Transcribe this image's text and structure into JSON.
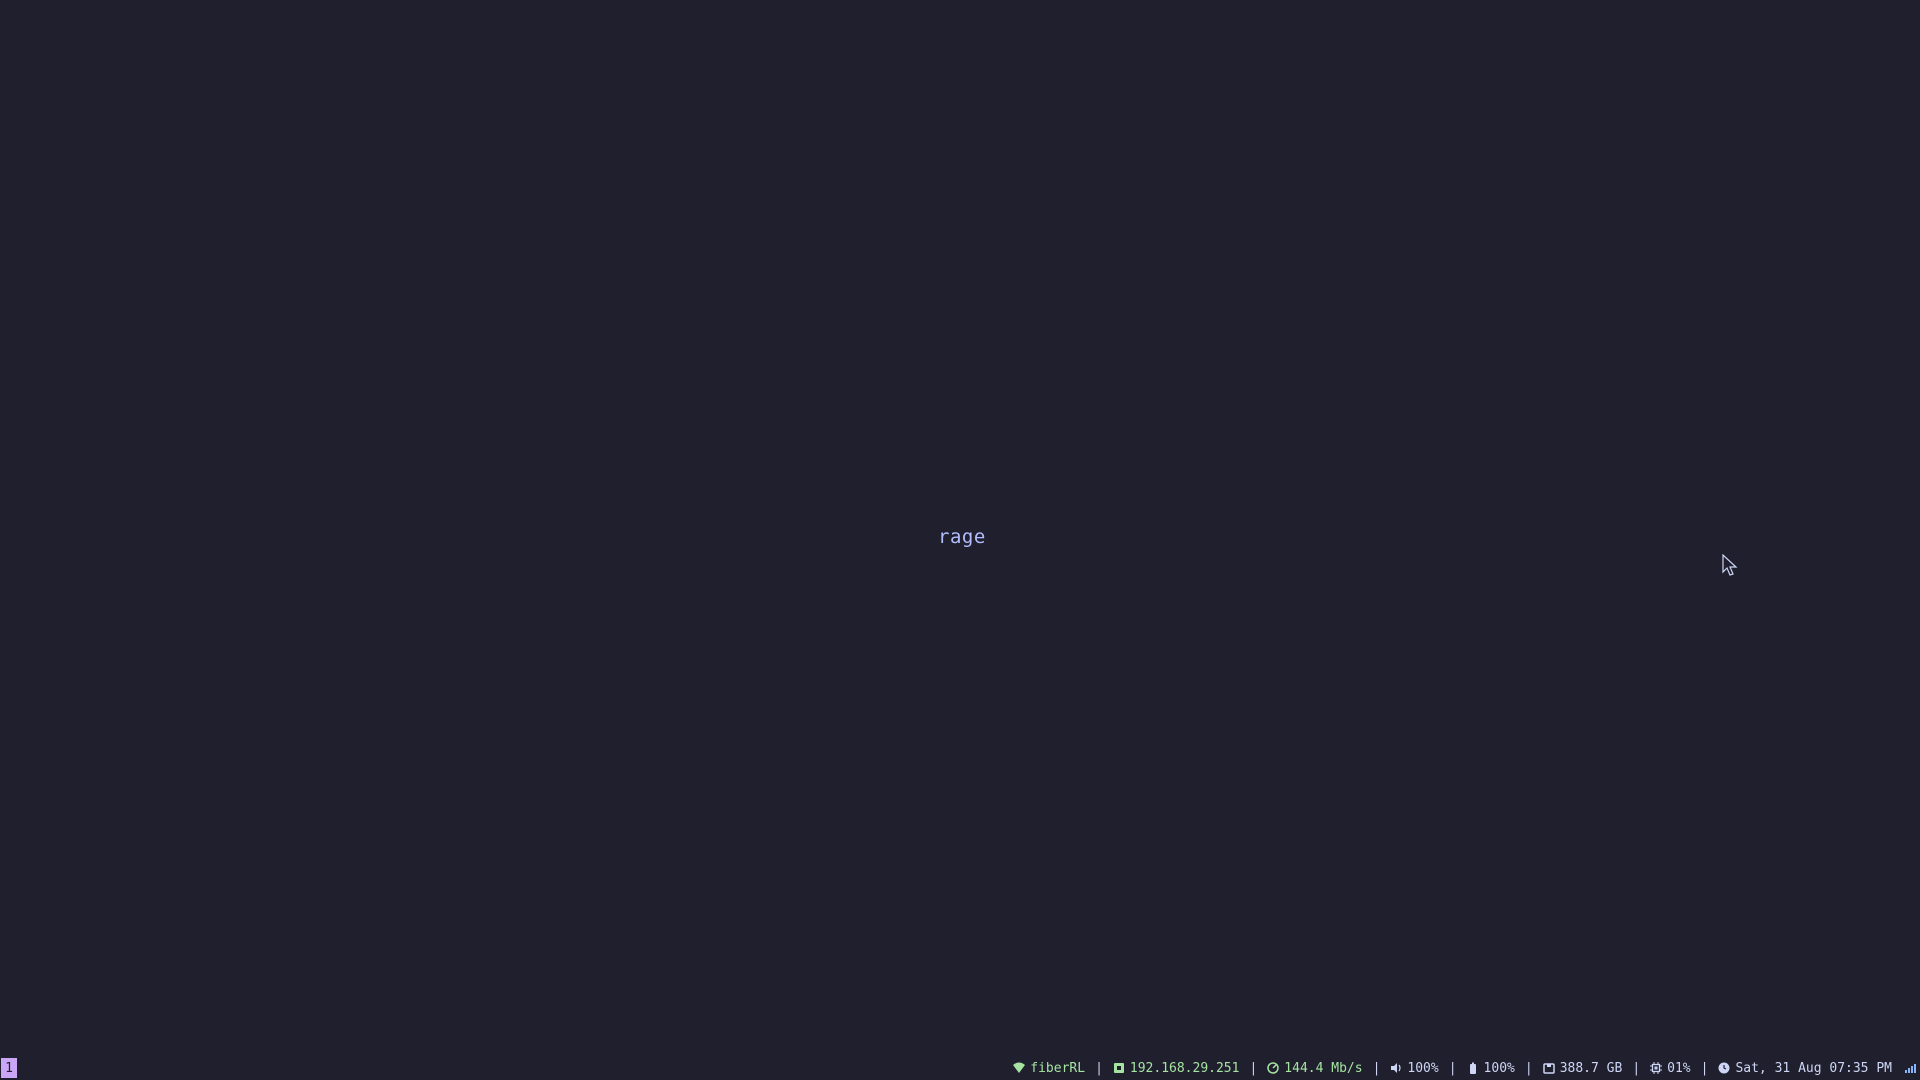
{
  "desktop": {
    "center_text": "rage"
  },
  "bar": {
    "workspace": "1",
    "wifi": {
      "icon": "wifi-icon",
      "label": "fiberRL"
    },
    "ip": {
      "icon": "ethernet-icon",
      "label": "192.168.29.251"
    },
    "speed": {
      "icon": "speedometer-icon",
      "label": "144.4 Mb/s"
    },
    "volume": {
      "icon": "volume-icon",
      "label": "100%"
    },
    "battery": {
      "icon": "battery-icon",
      "label": "100%"
    },
    "disk": {
      "icon": "disk-icon",
      "label": "388.7 GB"
    },
    "cpu": {
      "icon": "cpu-icon",
      "label": "01%"
    },
    "clock": {
      "icon": "clock-icon",
      "label": "Sat, 31 Aug 07:35 PM"
    },
    "separator": "|",
    "tray": {
      "icon": "signal-bars-icon"
    }
  },
  "colors": {
    "background": "#1f1f2e",
    "accent": "#cba6f7",
    "green": "#a6e3a1",
    "text": "#cdd6f4",
    "label": "#b4befe"
  }
}
